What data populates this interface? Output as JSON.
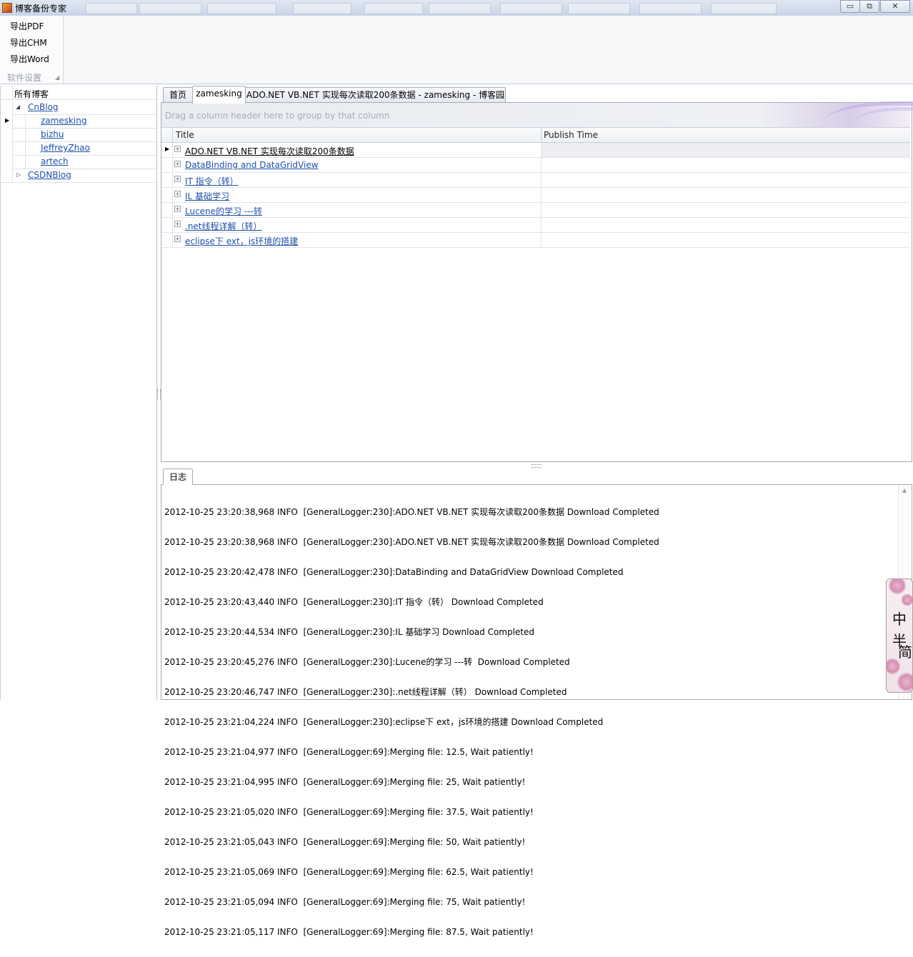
{
  "window": {
    "title": "博客备份专家",
    "buttons": {
      "minimize": "▭",
      "restore": "⧉",
      "close": "✕"
    }
  },
  "ribbon": {
    "buttons": [
      "导出PDF",
      "导出CHM",
      "导出Word"
    ],
    "group_label": "软件设置"
  },
  "tree": {
    "root": "所有博客",
    "items": [
      {
        "label": "CnBlog",
        "expanded": true
      },
      {
        "label": "zamesking",
        "selected": true
      },
      {
        "label": "bizhu"
      },
      {
        "label": "JeffreyZhao"
      },
      {
        "label": "artech"
      },
      {
        "label": "CSDNBlog",
        "expanded": false
      }
    ]
  },
  "tabs": [
    {
      "label": "首页"
    },
    {
      "label": "zamesking",
      "active": true
    },
    {
      "label": "ADO.NET VB.NET 实现每次读取200条数据 - zamesking - 博客园"
    }
  ],
  "grid": {
    "group_hint": "Drag a column header here to group by that column",
    "columns": [
      "Title",
      "Publish Time"
    ],
    "rows": [
      {
        "title": "ADO.NET VB.NET 实现每次读取200条数据",
        "publish": ""
      },
      {
        "title": "DataBinding and DataGridView",
        "publish": ""
      },
      {
        "title": "IT 指令（转）",
        "publish": ""
      },
      {
        "title": "IL 基础学习",
        "publish": ""
      },
      {
        "title": "Lucene的学习 ---转",
        "publish": ""
      },
      {
        "title": ".net线程详解（转）",
        "publish": ""
      },
      {
        "title": "eclipse下 ext，js环境的搭建",
        "publish": ""
      }
    ]
  },
  "log": {
    "tab": "日志",
    "lines": [
      "2012-10-25 23:20:38,968 INFO  [GeneralLogger:230]:ADO.NET VB.NET 实现每次读取200条数据 Download Completed",
      "2012-10-25 23:20:38,968 INFO  [GeneralLogger:230]:ADO.NET VB.NET 实现每次读取200条数据 Download Completed",
      "2012-10-25 23:20:42,478 INFO  [GeneralLogger:230]:DataBinding and DataGridView Download Completed",
      "2012-10-25 23:20:43,440 INFO  [GeneralLogger:230]:IT 指令（转） Download Completed",
      "2012-10-25 23:20:44,534 INFO  [GeneralLogger:230]:IL 基础学习 Download Completed",
      "2012-10-25 23:20:45,276 INFO  [GeneralLogger:230]:Lucene的学习 ---转  Download Completed",
      "2012-10-25 23:20:46,747 INFO  [GeneralLogger:230]:.net线程详解（转） Download Completed",
      "2012-10-25 23:21:04,224 INFO  [GeneralLogger:230]:eclipse下 ext，js环境的搭建 Download Completed",
      "2012-10-25 23:21:04,977 INFO  [GeneralLogger:69]:Merging file: 12.5, Wait patiently!",
      "2012-10-25 23:21:04,995 INFO  [GeneralLogger:69]:Merging file: 25, Wait patiently!",
      "2012-10-25 23:21:05,020 INFO  [GeneralLogger:69]:Merging file: 37.5, Wait patiently!",
      "2012-10-25 23:21:05,043 INFO  [GeneralLogger:69]:Merging file: 50, Wait patiently!",
      "2012-10-25 23:21:05,069 INFO  [GeneralLogger:69]:Merging file: 62.5, Wait patiently!",
      "2012-10-25 23:21:05,094 INFO  [GeneralLogger:69]:Merging file: 75, Wait patiently!",
      "2012-10-25 23:21:05,117 INFO  [GeneralLogger:69]:Merging file: 87.5, Wait patiently!"
    ]
  },
  "ime": {
    "chars": [
      "中",
      "半",
      "简"
    ]
  },
  "colors": {
    "link": "#1f4fa8",
    "grid_border": "#a4acb8",
    "ime_accent": "#d58fb3"
  }
}
